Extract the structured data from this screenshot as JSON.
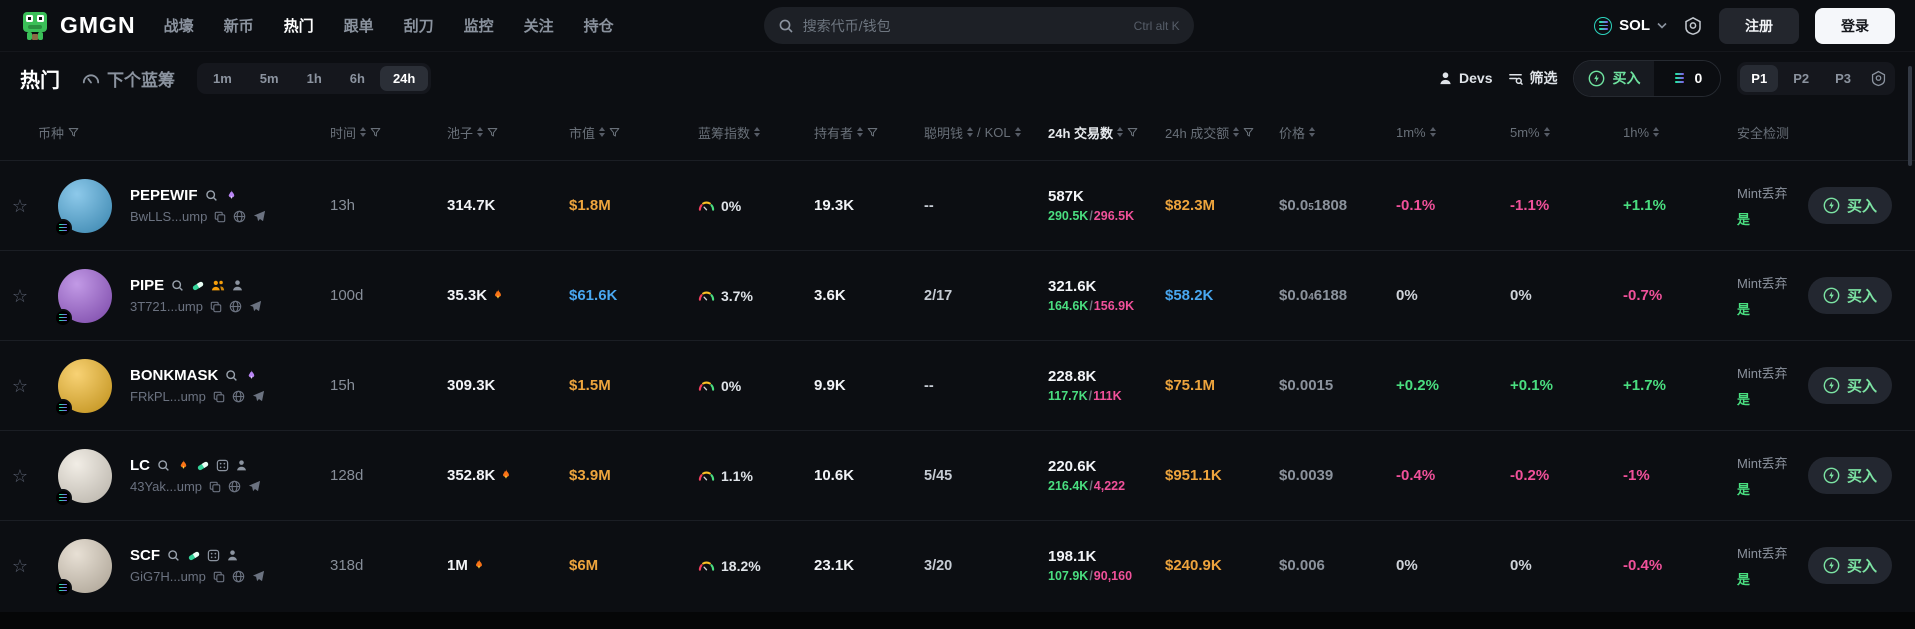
{
  "brand": {
    "name": "GMGN"
  },
  "nav": [
    {
      "label": "战壕"
    },
    {
      "label": "新币"
    },
    {
      "label": "热门",
      "active": true
    },
    {
      "label": "跟单"
    },
    {
      "label": "刮刀"
    },
    {
      "label": "监控"
    },
    {
      "label": "关注"
    },
    {
      "label": "持仓"
    }
  ],
  "search": {
    "placeholder": "搜索代币/钱包",
    "shortcut": "Ctrl alt K"
  },
  "header_right": {
    "chain": "SOL",
    "register": "注册",
    "login": "登录"
  },
  "toolbar": {
    "title": "热门",
    "next_bluechip": "下个蓝筹",
    "timeframes": [
      "1m",
      "5m",
      "1h",
      "6h",
      "24h"
    ],
    "active_timeframe": "24h",
    "devs": "Devs",
    "filter": "筛选",
    "buy_label": "买入",
    "buy_amount": "0",
    "presets": [
      "P1",
      "P2",
      "P3"
    ],
    "active_preset": "P1"
  },
  "table_headers": {
    "coin": "币种",
    "time": "时间",
    "pool": "池子",
    "mcap": "市值",
    "bluechip": "蓝筹指数",
    "holders": "持有者",
    "smart": "聪明钱",
    "kol": "KOL",
    "tx": "24h 交易数",
    "vol": "24h 成交额",
    "price": "价格",
    "m1": "1m%",
    "m5": "5m%",
    "h1": "1h%",
    "safety": "安全检测"
  },
  "colors": {
    "green": "#4ade80",
    "pink": "#f0519a",
    "yellow": "#eda43d",
    "blue": "#49a7f0",
    "buy_green": "#7ce3a3"
  },
  "rows": [
    {
      "name": "PEPEWIF",
      "address": "BwLLS...ump",
      "avatar_bg": "#47a8dd",
      "badges": [
        "flame-purple"
      ],
      "time": "13h",
      "pool": "314.7K",
      "pool_fire": false,
      "mcap": "$1.8M",
      "mcap_c": "yellow",
      "bluechip": "0%",
      "holders": "19.3K",
      "smart": "--",
      "tx": "587K",
      "tx_buys": "290.5K",
      "tx_sells": "296.5K",
      "vol": "$82.3M",
      "vol_c": "yellow",
      "price_pre": "$0.0",
      "price_sub": "5",
      "price_post": "1808",
      "m1": "-0.1%",
      "m5": "-1.1%",
      "h1": "+1.1%",
      "safety_label": "Mint丢弃",
      "safety_value": "是",
      "buy": "买入"
    },
    {
      "name": "PIPE",
      "address": "3T721...ump",
      "avatar_bg": "#9c5bd6",
      "badges": [
        "pill",
        "people",
        "person"
      ],
      "time": "100d",
      "pool": "35.3K",
      "pool_fire": true,
      "mcap": "$61.6K",
      "mcap_c": "blue",
      "bluechip": "3.7%",
      "holders": "3.6K",
      "smart": "2/17",
      "tx": "321.6K",
      "tx_buys": "164.6K",
      "tx_sells": "156.9K",
      "vol": "$58.2K",
      "vol_c": "blue",
      "price_pre": "$0.0",
      "price_sub": "4",
      "price_post": "6188",
      "m1": "0%",
      "m5": "0%",
      "h1": "-0.7%",
      "safety_label": "Mint丢弃",
      "safety_value": "是",
      "buy": "买入"
    },
    {
      "name": "BONKMASK",
      "address": "FRkPL...ump",
      "avatar_bg": "#f3b61f",
      "badges": [
        "flame-purple"
      ],
      "time": "15h",
      "pool": "309.3K",
      "pool_fire": false,
      "mcap": "$1.5M",
      "mcap_c": "yellow",
      "bluechip": "0%",
      "holders": "9.9K",
      "smart": "--",
      "tx": "228.8K",
      "tx_buys": "117.7K",
      "tx_sells": "111K",
      "vol": "$75.1M",
      "vol_c": "yellow",
      "price_pre": "$0.0015",
      "price_sub": "",
      "price_post": "",
      "m1": "+0.2%",
      "m5": "+0.1%",
      "h1": "+1.7%",
      "safety_label": "Mint丢弃",
      "safety_value": "是",
      "buy": "买入"
    },
    {
      "name": "LC",
      "address": "43Yak...ump",
      "avatar_bg": "#e9e2d6",
      "badges": [
        "flame-orange",
        "pill",
        "badge",
        "person"
      ],
      "time": "128d",
      "pool": "352.8K",
      "pool_fire": true,
      "mcap": "$3.9M",
      "mcap_c": "yellow",
      "bluechip": "1.1%",
      "holders": "10.6K",
      "smart": "5/45",
      "tx": "220.6K",
      "tx_buys": "216.4K",
      "tx_sells": "4,222",
      "vol": "$951.1K",
      "vol_c": "yellow",
      "price_pre": "$0.0039",
      "price_sub": "",
      "price_post": "",
      "m1": "-0.4%",
      "m5": "-0.2%",
      "h1": "-1%",
      "safety_label": "Mint丢弃",
      "safety_value": "是",
      "buy": "买入"
    },
    {
      "name": "SCF",
      "address": "GiG7H...ump",
      "avatar_bg": "#d9cdbb",
      "badges": [
        "pill",
        "badge",
        "person"
      ],
      "time": "318d",
      "pool": "1M",
      "pool_fire": true,
      "mcap": "$6M",
      "mcap_c": "yellow",
      "bluechip": "18.2%",
      "holders": "23.1K",
      "smart": "3/20",
      "tx": "198.1K",
      "tx_buys": "107.9K",
      "tx_sells": "90,160",
      "vol": "$240.9K",
      "vol_c": "yellow",
      "price_pre": "$0.006",
      "price_sub": "",
      "price_post": "",
      "m1": "0%",
      "m5": "0%",
      "h1": "-0.4%",
      "safety_label": "Mint丢弃",
      "safety_value": "是",
      "buy": "买入"
    }
  ]
}
